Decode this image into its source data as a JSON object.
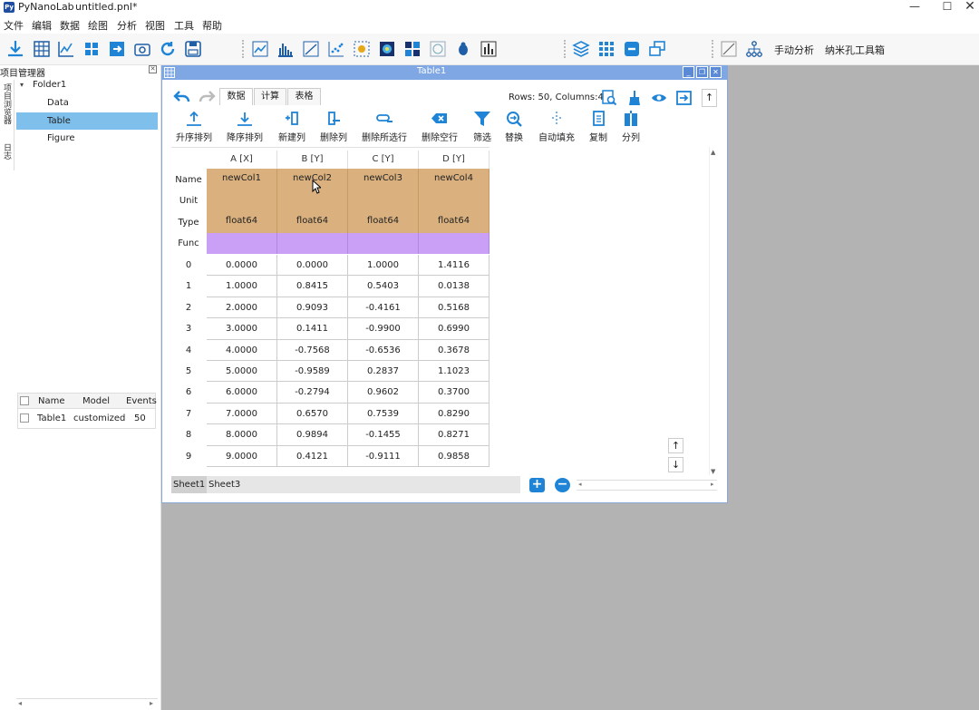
{
  "app": {
    "name": "PyNanoLab",
    "document": "untitled.pnl*"
  },
  "menu": [
    "文件",
    "编辑",
    "数据",
    "绘图",
    "分析",
    "视图",
    "工具",
    "帮助"
  ],
  "toolbar": {
    "manual_analysis": "手动分析",
    "nanopore_toolbox": "纳米孔工具箱"
  },
  "project_manager": {
    "title": "项目管理器",
    "vertical_tabs": [
      "项目浏览器",
      "日志"
    ],
    "tree": {
      "folder": "Folder1",
      "items": [
        "Data",
        "Table",
        "Figure"
      ],
      "selected": "Table"
    },
    "properties": {
      "headers": [
        "Name",
        "Model",
        "Events"
      ],
      "rows": [
        {
          "name": "Table1",
          "model": "customized",
          "events": "50"
        }
      ]
    }
  },
  "table_window": {
    "title": "Table1",
    "tabs": [
      "数据",
      "计算",
      "表格"
    ],
    "active_tab": "数据",
    "info": "Rows: 50, Columns:4",
    "actions": [
      "升序排列",
      "降序排列",
      "新建列",
      "删除列",
      "删除所选行",
      "删除空行",
      "筛选",
      "替换",
      "自动填充",
      "复制",
      "分列"
    ],
    "columns": [
      "A [X]",
      "B [Y]",
      "C [Y]",
      "D [Y]"
    ],
    "meta_labels": [
      "Name",
      "Unit",
      "Type",
      "Func"
    ],
    "names": [
      "newCol1",
      "newCol2",
      "newCol3",
      "newCol4"
    ],
    "units": [
      "",
      "",
      "",
      ""
    ],
    "types": [
      "float64",
      "float64",
      "float64",
      "float64"
    ],
    "rows": [
      {
        "idx": "0",
        "a": "0.0000",
        "b": "0.0000",
        "c": "1.0000",
        "d": "1.4116"
      },
      {
        "idx": "1",
        "a": "1.0000",
        "b": "0.8415",
        "c": "0.5403",
        "d": "0.0138"
      },
      {
        "idx": "2",
        "a": "2.0000",
        "b": "0.9093",
        "c": "-0.4161",
        "d": "0.5168"
      },
      {
        "idx": "3",
        "a": "3.0000",
        "b": "0.1411",
        "c": "-0.9900",
        "d": "0.6990"
      },
      {
        "idx": "4",
        "a": "4.0000",
        "b": "-0.7568",
        "c": "-0.6536",
        "d": "0.3678"
      },
      {
        "idx": "5",
        "a": "5.0000",
        "b": "-0.9589",
        "c": "0.2837",
        "d": "1.1023"
      },
      {
        "idx": "6",
        "a": "6.0000",
        "b": "-0.2794",
        "c": "0.9602",
        "d": "0.3700"
      },
      {
        "idx": "7",
        "a": "7.0000",
        "b": "0.6570",
        "c": "0.7539",
        "d": "0.8290"
      },
      {
        "idx": "8",
        "a": "8.0000",
        "b": "0.9894",
        "c": "-0.1455",
        "d": "0.8271"
      },
      {
        "idx": "9",
        "a": "9.0000",
        "b": "0.4121",
        "c": "-0.9111",
        "d": "0.9858"
      }
    ],
    "sheets": [
      "Sheet1",
      "Sheet3"
    ]
  }
}
